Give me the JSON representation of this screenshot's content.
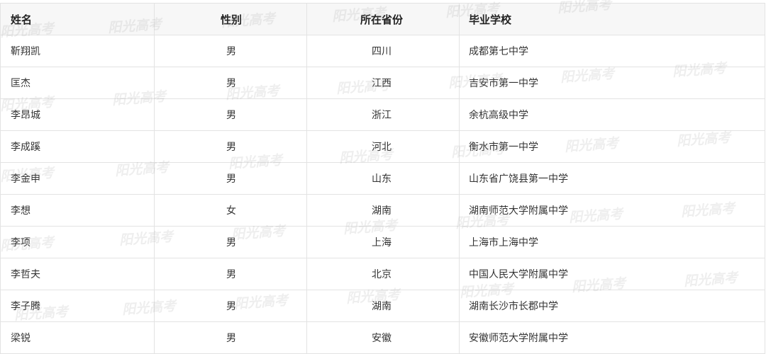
{
  "table": {
    "headers": [
      "姓名",
      "性别",
      "所在省份",
      "毕业学校"
    ],
    "rows": [
      [
        "靳翔凯",
        "男",
        "四川",
        "成都第七中学"
      ],
      [
        "匡杰",
        "男",
        "江西",
        "吉安市第一中学"
      ],
      [
        "李昂城",
        "男",
        "浙江",
        "余杭高级中学"
      ],
      [
        "李成蹊",
        "男",
        "河北",
        "衡水市第一中学"
      ],
      [
        "李金申",
        "男",
        "山东",
        "山东省广饶县第一中学"
      ],
      [
        "李想",
        "女",
        "湖南",
        "湖南师范大学附属中学"
      ],
      [
        "李项",
        "男",
        "上海",
        "上海市上海中学"
      ],
      [
        "李哲夫",
        "男",
        "北京",
        "中国人民大学附属中学"
      ],
      [
        "李子腾",
        "男",
        "湖南",
        "湖南长沙市长郡中学"
      ],
      [
        "梁锐",
        "男",
        "安徽",
        "安徽师范大学附属中学"
      ]
    ]
  },
  "watermark": "阳光高考"
}
